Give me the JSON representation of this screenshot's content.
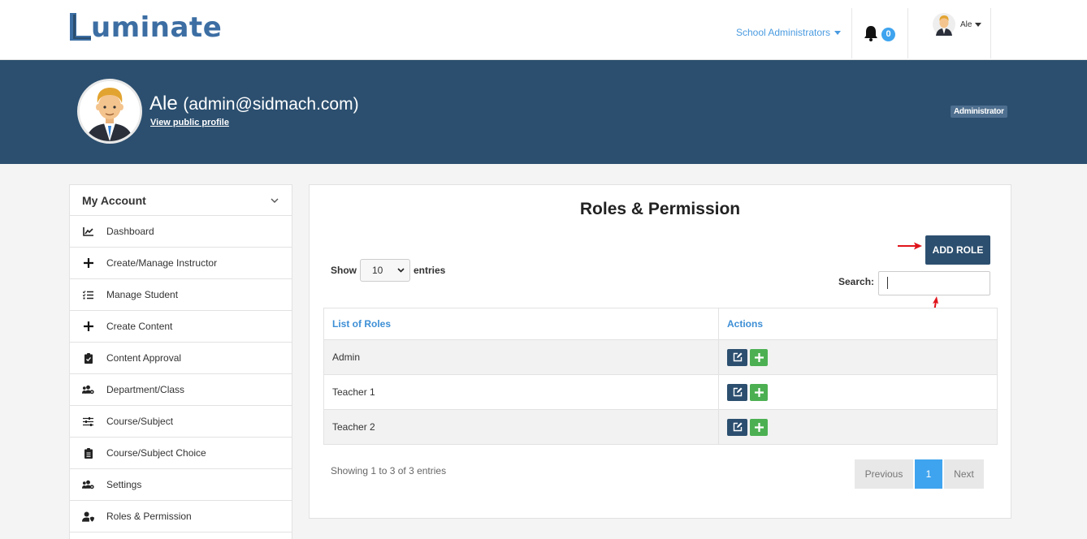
{
  "brand": {
    "name": "uminate",
    "color": "#3c6ea3"
  },
  "topnav": {
    "role_menu": "School Administrators",
    "notifications_count": "0",
    "user_name": "Ale"
  },
  "profile": {
    "name": "Ale",
    "email": "(admin@sidmach.com)",
    "public_profile_link": "View public profile",
    "role_tag": "Administrator"
  },
  "sidebar": {
    "title": "My Account",
    "items": [
      {
        "label": "Dashboard",
        "icon": "chart-line-icon"
      },
      {
        "label": "Create/Manage Instructor",
        "icon": "plus-icon"
      },
      {
        "label": "Manage Student",
        "icon": "tasks-icon"
      },
      {
        "label": "Create Content",
        "icon": "plus-icon"
      },
      {
        "label": "Content Approval",
        "icon": "clipboard-check-icon"
      },
      {
        "label": "Department/Class",
        "icon": "users-cog-icon"
      },
      {
        "label": "Course/Subject",
        "icon": "sliders-icon"
      },
      {
        "label": "Course/Subject Choice",
        "icon": "clipboard-list-icon"
      },
      {
        "label": "Settings",
        "icon": "users-cog-icon"
      },
      {
        "label": "Roles & Permission",
        "icon": "user-shield-icon"
      }
    ]
  },
  "main": {
    "title": "Roles & Permission",
    "add_button": "ADD ROLE",
    "show_label": "Show",
    "entries_label": "entries",
    "page_length": "10",
    "search_label": "Search:",
    "search_value": "",
    "columns": [
      "List of Roles",
      "Actions"
    ],
    "rows": [
      {
        "role": "Admin"
      },
      {
        "role": "Teacher 1"
      },
      {
        "role": "Teacher 2"
      }
    ],
    "info": "Showing 1 to 3 of 3 entries",
    "pagination": {
      "previous": "Previous",
      "current": "1",
      "next": "Next"
    }
  },
  "colors": {
    "banner": "#2c4f6f",
    "accent_blue": "#3fa4ef",
    "link_blue": "#3d8fd6",
    "success_green": "#4cb052",
    "annotation_red": "#e0141b"
  }
}
